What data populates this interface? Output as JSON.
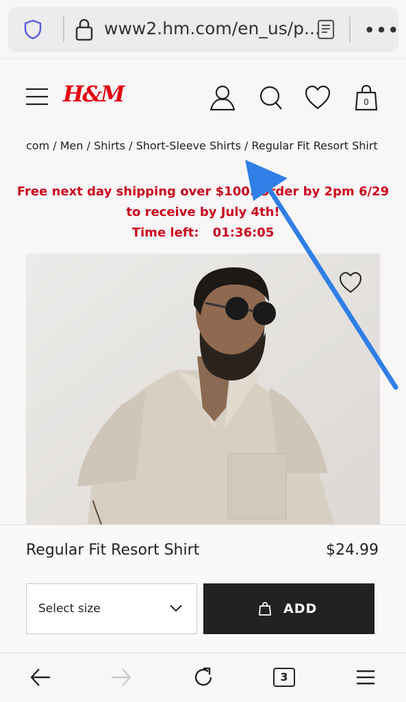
{
  "browser": {
    "url": "www2.hm.com/en_us/p...",
    "tab_count": "3"
  },
  "header": {
    "logo": "H&M"
  },
  "breadcrumb": "com / Men / Shirts / Short-Sleeve Shirts / Regular Fit Resort Shirt",
  "promo": {
    "line1": "Free next day shipping over $100: Order by 2pm 6/29",
    "line2": "to receive by July 4th!",
    "timer_label": "Time left:",
    "timer_value": "01:36:05"
  },
  "product": {
    "name": "Regular Fit Resort Shirt",
    "price": "$24.99",
    "size_select": "Select size",
    "add_label": "ADD"
  },
  "colors": {
    "brand_red": "#e50010",
    "promo_red": "#cc071e",
    "button_dark": "#222222",
    "annotation_arrow": "#2f7fe6"
  }
}
